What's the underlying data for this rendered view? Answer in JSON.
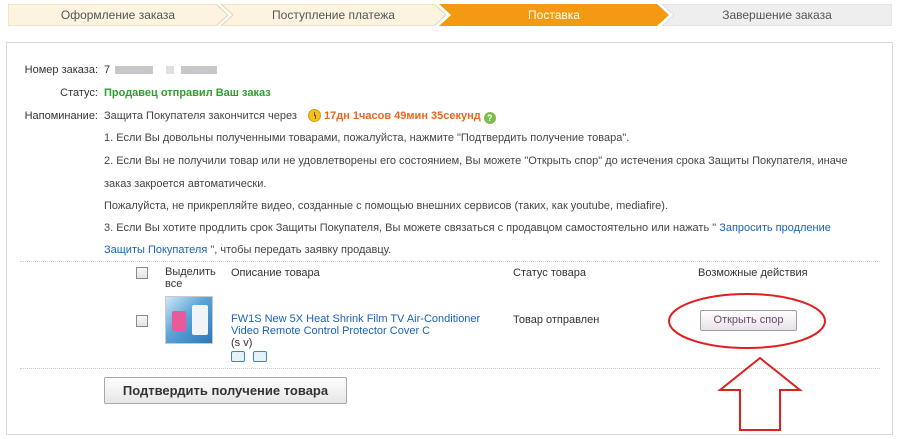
{
  "steps": [
    {
      "label": "Оформление заказа",
      "state": "done"
    },
    {
      "label": "Поступление платежа",
      "state": "done"
    },
    {
      "label": "Поставка",
      "state": "active"
    },
    {
      "label": "Завершение заказа",
      "state": "pending"
    }
  ],
  "order": {
    "number_label": "Номер заказа:",
    "number_value": "7",
    "status_label": "Статус:",
    "status_value": "Продавец отправил Ваш заказ",
    "reminder_label": "Напоминание:",
    "reminder_text": "Защита Покупателя закончится через",
    "timer": "17дн 1часов 49мин 35секунд",
    "help_icon": "?"
  },
  "notes": {
    "n1": "1. Если Вы довольны полученными товарами, пожалуйста, нажмите \"Подтвердить получение товара\".",
    "n2a": "2. Если Вы не получили товар или не удовлетворены его состоянием, Вы можете \"Открыть спор\" до истечения срока Защиты Покупателя, иначе",
    "n2b": "заказ закроется автоматически.",
    "n2c": "Пожалуйста, не прикрепляйте видео, созданные с помощью внешних сервисов (таких, как youtube, mediafire).",
    "n3a": "3. Если Вы хотите продлить срок Защиты Покупателя, Вы можете связаться с продавцом самостоятельно или нажать \"",
    "n3_link_a": "Запросить продление",
    "n3_link_b": "Защиты Покупателя",
    "n3b": "\", чтобы передать заявку продавцу."
  },
  "table": {
    "col_select": "Выделить все",
    "col_desc": "Описание товара",
    "col_status": "Статус товара",
    "col_actions": "Возможные действия",
    "item": {
      "title": "FW1S New 5X Heat Shrink Film TV Air-Conditioner Video Remote Control Protector Cover C",
      "variant": "(s v)",
      "status": "Товар отправлен",
      "action": "Открыть спор"
    }
  },
  "confirm_button": "Подтвердить получение товара",
  "colors": {
    "active_step": "#f39a12",
    "step_done": "#fdf3df",
    "step_pending": "#eeeeee",
    "status_green": "#2e9e2e",
    "timer_orange": "#e8671d",
    "link_blue": "#1b62b5",
    "annotation_red": "#e02020"
  },
  "icons": [
    "clock-icon",
    "help-icon",
    "shipping-icon",
    "message-icon"
  ]
}
